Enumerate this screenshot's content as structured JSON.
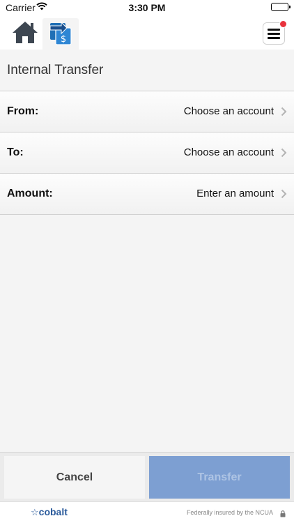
{
  "status_bar": {
    "carrier": "Carrier",
    "time": "3:30 PM"
  },
  "nav": {
    "tabs": [
      {
        "name": "home",
        "icon": "home-icon"
      },
      {
        "name": "transfer",
        "icon": "transfer-icon",
        "selected": true
      }
    ],
    "menu_icon": "hamburger-menu-icon",
    "notification_color": "#e8323c"
  },
  "page": {
    "title": "Internal Transfer"
  },
  "form": {
    "rows": [
      {
        "label": "From:",
        "value": "Choose an account"
      },
      {
        "label": "To:",
        "value": "Choose an account"
      },
      {
        "label": "Amount:",
        "value": "Enter an amount"
      }
    ]
  },
  "buttons": {
    "cancel": "Cancel",
    "transfer": "Transfer",
    "transfer_color": "#7d9fd2"
  },
  "footer": {
    "logo": "cobalt",
    "notice": "Federally insured by the NCUA"
  }
}
